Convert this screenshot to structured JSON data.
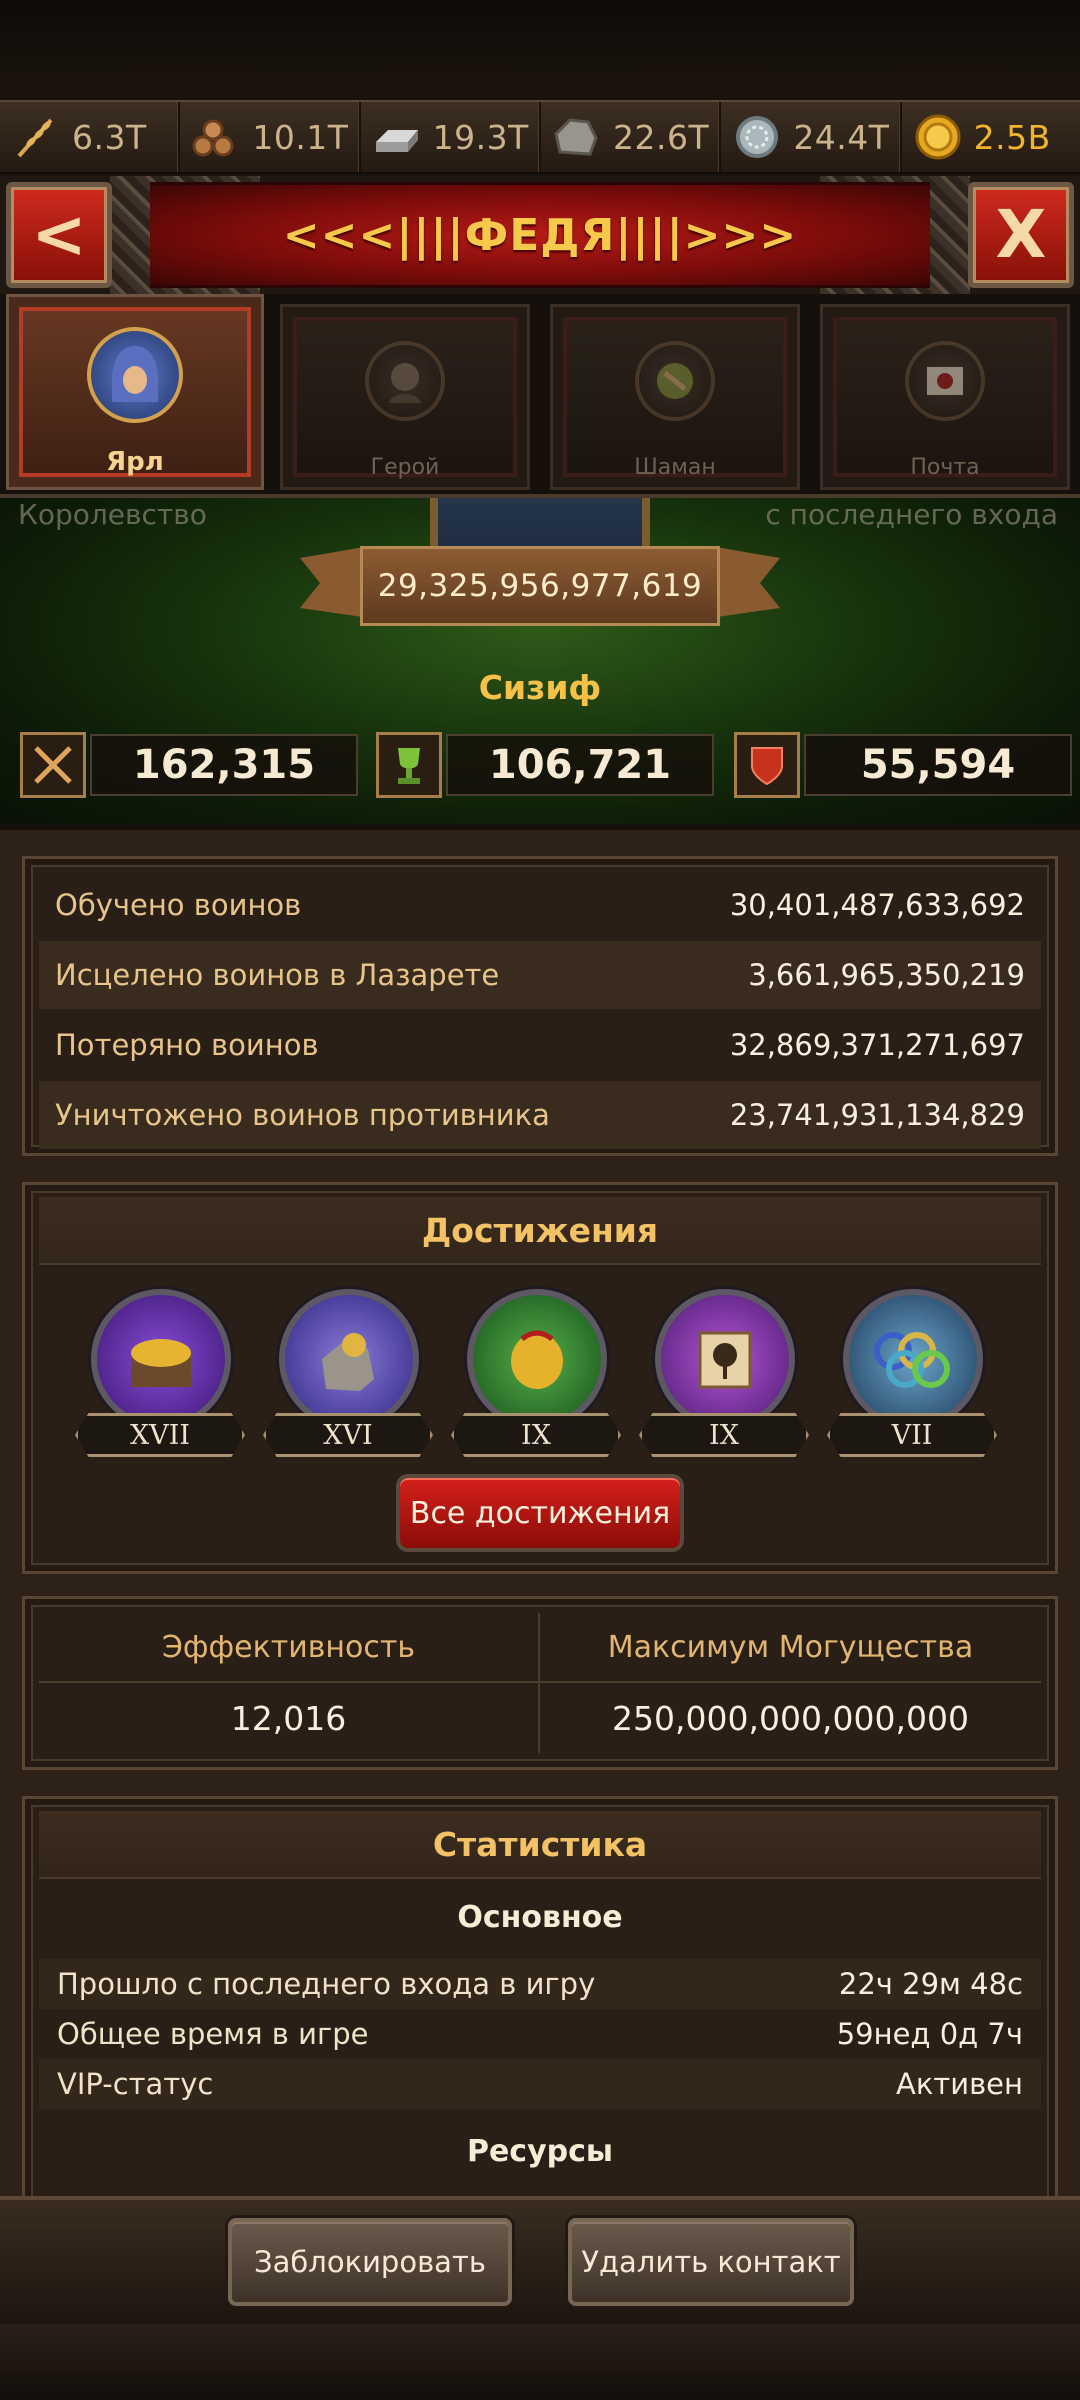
{
  "resources": [
    {
      "icon": "wheat-icon",
      "value": "6.3T"
    },
    {
      "icon": "wood-icon",
      "value": "10.1T"
    },
    {
      "icon": "iron-icon",
      "value": "19.3T"
    },
    {
      "icon": "stone-icon",
      "value": "22.6T"
    },
    {
      "icon": "silver-icon",
      "value": "24.4T"
    },
    {
      "icon": "gold-coin-icon",
      "value": "2.5B"
    }
  ],
  "header": {
    "title": "<<<||||ФЕДЯ||||>>>",
    "back_label": "<",
    "close_label": "X"
  },
  "tabs": [
    {
      "label": "Ярл",
      "active": true
    },
    {
      "label": "Герой",
      "active": false
    },
    {
      "label": "Шаман",
      "active": false
    },
    {
      "label": "Почта",
      "active": false
    }
  ],
  "profile": {
    "ghost_left": "Королевство",
    "ghost_right": "с последнего входа",
    "power": "29,325,956,977,619",
    "name": "Сизиф",
    "stats": [
      {
        "icon": "swords-icon",
        "value": "162,315"
      },
      {
        "icon": "trophy-icon",
        "value": "106,721"
      },
      {
        "icon": "shield-icon",
        "value": "55,594"
      }
    ]
  },
  "war_stats": [
    {
      "label": "Обучено воинов",
      "value": "30,401,487,633,692"
    },
    {
      "label": "Исцелено воинов в Лазарете",
      "value": "3,661,965,350,219"
    },
    {
      "label": "Потеряно воинов",
      "value": "32,869,371,271,697"
    },
    {
      "label": "Уничтожено воинов противника",
      "value": "23,741,931,134,829"
    }
  ],
  "achievements": {
    "title": "Достижения",
    "badges": [
      {
        "icon": "treasure-chest-icon",
        "level": "XVII",
        "color": "#5b2aa0"
      },
      {
        "icon": "stone-trophy-icon",
        "level": "XVI",
        "color": "#4a3da8"
      },
      {
        "icon": "gold-horn-icon",
        "level": "IX",
        "color": "#2a7a2a"
      },
      {
        "icon": "scroll-tree-icon",
        "level": "IX",
        "color": "#7a2a9a"
      },
      {
        "icon": "rings-icon",
        "level": "VII",
        "color": "#2a4a8a"
      }
    ],
    "all_button": "Все достижения"
  },
  "efficiency": {
    "eff_label": "Эффективность",
    "eff_value": "12,016",
    "max_label": "Максимум Могущества",
    "max_value": "250,000,000,000,000"
  },
  "statistics": {
    "title": "Статистика",
    "basic_title": "Основное",
    "rows": [
      {
        "label": "Прошло с последнего входа в игру",
        "value": "22ч 29м 48с"
      },
      {
        "label": "Общее время в игре",
        "value": "59нед 0д 7ч"
      },
      {
        "label": "VIP-статус",
        "value": "Активен"
      }
    ],
    "resources_title": "Ресурсы"
  },
  "footer": {
    "block_label": "Заблокировать",
    "delete_label": "Удалить контакт"
  },
  "colors": {
    "gold_text": "#f5c247",
    "red_button": "#d5201b",
    "banner_red": "#b51b16"
  }
}
